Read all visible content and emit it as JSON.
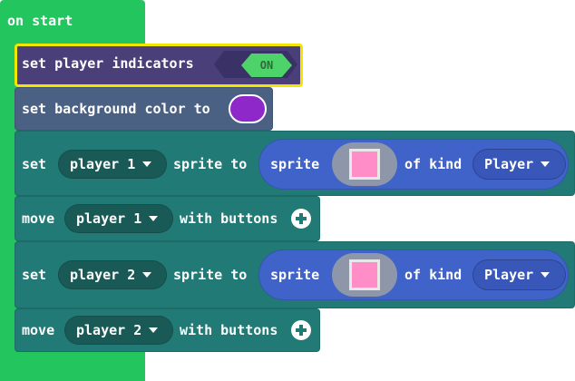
{
  "event": {
    "label": "on start"
  },
  "blocks": {
    "indicators": {
      "label": "set player indicators",
      "toggle": "ON"
    },
    "background": {
      "label": "set background color to",
      "color": "#8e28c8"
    },
    "set_p1": {
      "set": "set",
      "player": "player 1",
      "sprite_to": "sprite to",
      "sprite": "sprite",
      "of_kind": "of kind",
      "kind": "Player"
    },
    "move_p1": {
      "move": "move",
      "player": "player 1",
      "with_buttons": "with buttons"
    },
    "set_p2": {
      "set": "set",
      "player": "player 2",
      "sprite_to": "sprite to",
      "sprite": "sprite",
      "of_kind": "of kind",
      "kind": "Player"
    },
    "move_p2": {
      "move": "move",
      "player": "player 2",
      "with_buttons": "with buttons"
    }
  },
  "colors": {
    "event_green": "#23c55f",
    "highlight_yellow": "#f2e600",
    "teal_block": "#217a75",
    "sprite_blue": "#3f63c9",
    "sprite_image_pink": "#ff8ec8"
  },
  "icons": [
    "chevron-down-icon",
    "add-circle-icon"
  ]
}
